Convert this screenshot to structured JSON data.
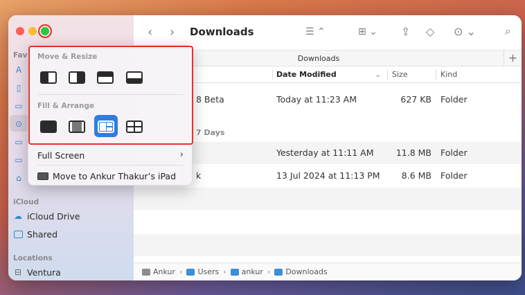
{
  "window": {
    "title": "Downloads",
    "tab_label": "Downloads"
  },
  "sidebar": {
    "favorites_label": "Favo",
    "icloud_label": "iCloud",
    "icloud_items": [
      {
        "label": "iCloud Drive",
        "icon": "cloud-icon"
      },
      {
        "label": "Shared",
        "icon": "shared-folder-icon"
      }
    ],
    "locations_label": "Locations",
    "location_items": [
      {
        "label": "Ventura",
        "icon": "disk-icon"
      }
    ]
  },
  "popup": {
    "move_resize_label": "Move & Resize",
    "fill_arrange_label": "Fill & Arrange",
    "full_screen_label": "Full Screen",
    "move_to_label": "Move to Ankur Thakur’s iPad"
  },
  "columns": {
    "date_modified": "Date Modified",
    "size": "Size",
    "kind": "Kind"
  },
  "rows": [
    {
      "name": "8 Beta",
      "date": "Today at 11:23 AM",
      "size": "627 KB",
      "kind": "Folder"
    },
    {
      "name": "",
      "date": "Yesterday at 11:11 AM",
      "size": "11.8 MB",
      "kind": "Folder"
    },
    {
      "name": "k",
      "date": "13 Jul 2024 at 11:13 PM",
      "size": "8.6 MB",
      "kind": "Folder"
    }
  ],
  "section_7days": "7 Days",
  "pathbar": [
    {
      "label": "Ankur",
      "icon": "disk-icon"
    },
    {
      "label": "Users",
      "icon": "folder-icon"
    },
    {
      "label": "ankur",
      "icon": "folder-icon"
    },
    {
      "label": "Downloads",
      "icon": "downloads-folder-icon"
    }
  ],
  "colors": {
    "accent": "#2f7de1",
    "highlight": "#e5312a"
  }
}
